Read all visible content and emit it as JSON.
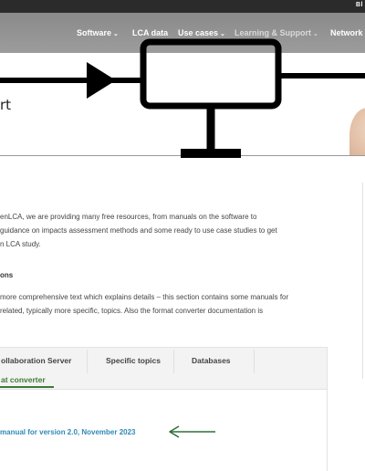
{
  "topbar": {
    "text": "Bl"
  },
  "nav": {
    "items": [
      {
        "label": "Software",
        "chevron": true
      },
      {
        "label": "LCA data",
        "chevron": false
      },
      {
        "label": "Use cases",
        "chevron": true
      },
      {
        "label": "Learning & Support",
        "chevron": true
      },
      {
        "label": "Network",
        "chevron": false
      }
    ],
    "chevron_glyph": "⌄"
  },
  "hero": {
    "title_fragment": "rt"
  },
  "content": {
    "intro_lines": [
      "enLCA, we are providing many free resources, from manuals on the software to",
      "guidance on impacts assessment methods and some ready to use case studies to get",
      "n LCA study."
    ],
    "section_heading": "ons",
    "para2_lines": [
      "more comprehensive text which explains details – this section contains some manuals for",
      "related, typically more specific, topics. Also the format converter documentation is"
    ]
  },
  "tabs": {
    "items": [
      "ollaboration Server",
      "Specific topics",
      "Databases"
    ],
    "active": "at converter"
  },
  "doc": {
    "link": "manual for version 2.0, November 2023"
  },
  "colors": {
    "accent_green": "#3d7a35",
    "link_blue": "#2f89b8",
    "annotation_arrow": "#2f6f3a"
  },
  "annotations": {
    "block_diagram_overlay": true,
    "left_arrow_icon": true
  }
}
